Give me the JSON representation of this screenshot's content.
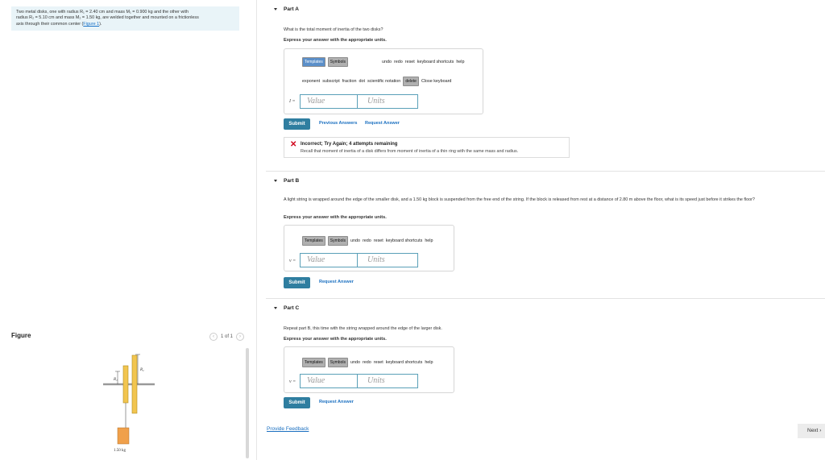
{
  "problem": {
    "line1": "Two metal disks, one with radius R₁ = 2.40 cm and mass M₁ = 0.900 kg and the other with",
    "line2": "radius R₂ = 5.10 cm and mass M₂ = 1.50 kg, are welded together and mounted on a frictionless",
    "line3_text": "axis through their common center (",
    "figure_link": "Figure 1",
    "line3_end": ")."
  },
  "figure": {
    "label": "Figure",
    "pager": "1 of 1",
    "r1": "R₁",
    "r2": "R₂",
    "mass_label": "1.50 kg"
  },
  "toolbar": {
    "templates": "Templates",
    "symbols": "Symbols",
    "undo": "undo",
    "redo": "redo",
    "reset": "reset",
    "keyboard_shortcuts": "keyboard shortcuts",
    "help": "help",
    "exponent": "exponent",
    "subscript": "subscript",
    "fraction": "fraction",
    "dot": "dot",
    "scientific_notation": "scientific notation",
    "delete": "delete",
    "close_keyboard": "Close keyboard"
  },
  "part_a": {
    "title": "Part A",
    "question": "What is the total moment of inertia of the two disks?",
    "instruction": "Express your answer with the appropriate units.",
    "var": "I =",
    "value_placeholder": "Value",
    "units_placeholder": "Units",
    "submit": "Submit",
    "previous_answers": "Previous Answers",
    "request_answer": "Request Answer",
    "feedback_title": "Incorrect; Try Again; 4 attempts remaining",
    "feedback_msg": "Recall that moment of inertia of a disk differs from moment of inertia of a thin ring with the same mass and radius."
  },
  "part_b": {
    "title": "Part B",
    "question": "A light string is wrapped around the edge of the smaller disk, and a 1.50 kg block is suspended from the free end of the string. If the block is released from rest at a distance of 2.80 m above the floor, what is its speed just before it strikes the floor?",
    "instruction": "Express your answer with the appropriate units.",
    "var": "v =",
    "value_placeholder": "Value",
    "units_placeholder": "Units",
    "submit": "Submit",
    "request_answer": "Request Answer"
  },
  "part_c": {
    "title": "Part C",
    "question": "Repeat part B, this time with the string wrapped around the edge of the larger disk.",
    "instruction": "Express your answer with the appropriate units.",
    "var": "v =",
    "value_placeholder": "Value",
    "units_placeholder": "Units",
    "submit": "Submit",
    "request_answer": "Request Answer"
  },
  "footer": {
    "provide_feedback": "Provide Feedback",
    "next": "Next"
  }
}
